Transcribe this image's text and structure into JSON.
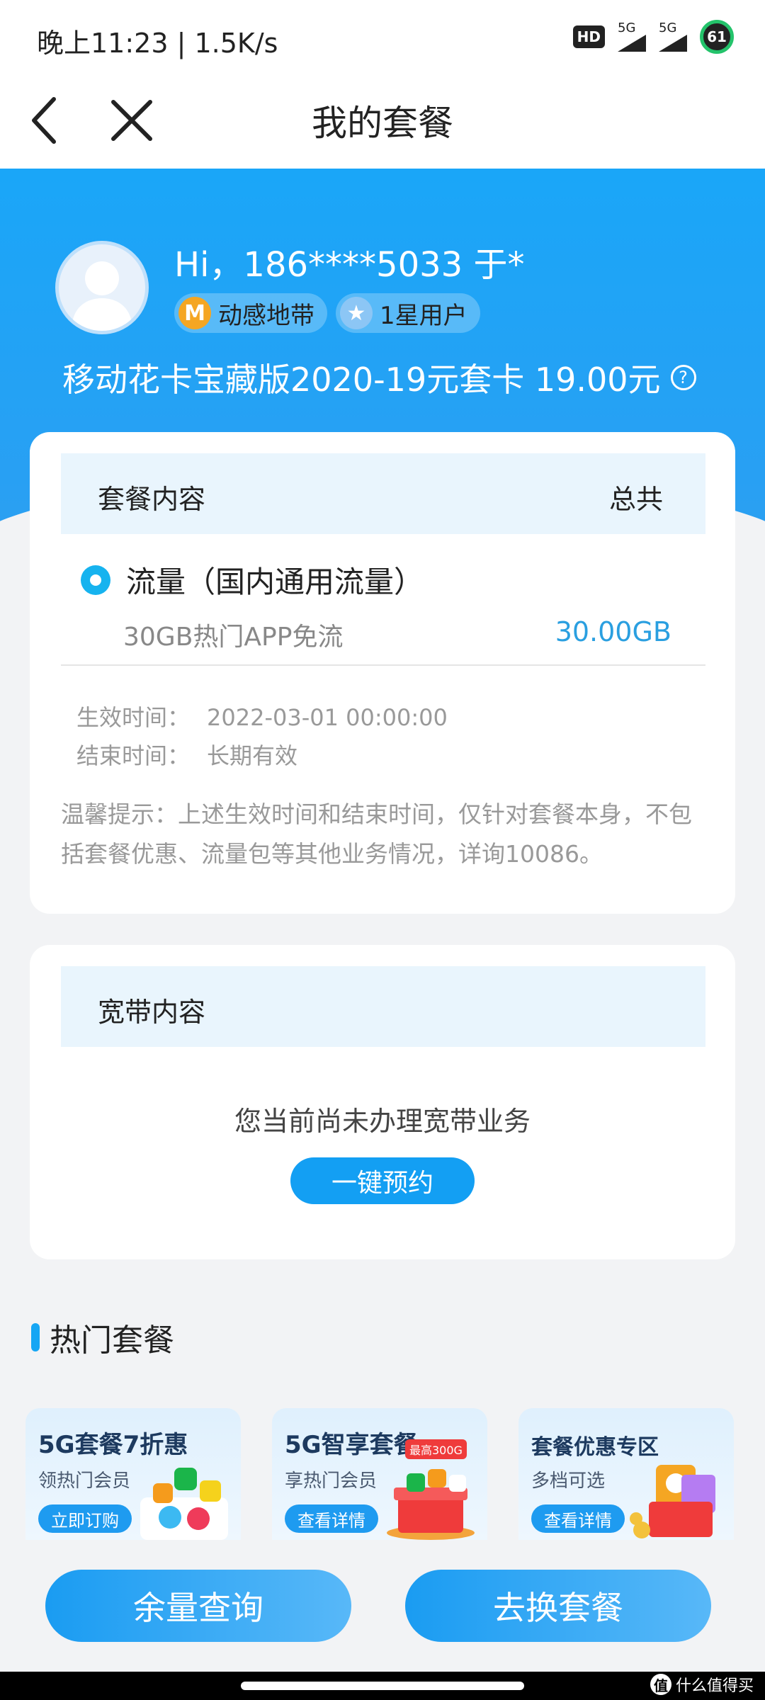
{
  "status_bar": {
    "time": "晚上11:23 | 1.5K/s",
    "hd": "HD",
    "signal1": "5G",
    "signal2": "5G",
    "battery": "61"
  },
  "header": {
    "title": "我的套餐"
  },
  "user": {
    "greeting": "Hi，186****5033 于*",
    "tag1": "动感地带",
    "tag1_icon_letter": "M",
    "tag2": "1星用户",
    "plan": "移动花卡宝藏版2020-19元套卡 19.00元",
    "help_glyph": "?"
  },
  "package_card": {
    "header_left": "套餐内容",
    "header_right": "总共",
    "item_title": "流量（国内通用流量）",
    "item_sub": "30GB热门APP免流",
    "item_value": "30.00GB",
    "start_label": "生效时间：",
    "start_value": "2022-03-01 00:00:00",
    "end_label": "结束时间：",
    "end_value": "长期有效",
    "tip": "温馨提示：上述生效时间和结束时间，仅针对套餐本身，不包括套餐优惠、流量包等其他业务情况，详询10086。"
  },
  "broadband_card": {
    "header": "宽带内容",
    "empty_text": "您当前尚未办理宽带业务",
    "button": "一键预约"
  },
  "hot": {
    "title": "热门套餐",
    "items": [
      {
        "title": "5G套餐7折惠",
        "sub": "领热门会员",
        "button": "立即订购",
        "badge": ""
      },
      {
        "title": "5G智享套餐",
        "sub": "享热门会员",
        "button": "查看详情",
        "badge": "最高300G"
      },
      {
        "title": "套餐优惠专区",
        "sub": "多档可选",
        "button": "查看详情",
        "badge": ""
      }
    ]
  },
  "bottom": {
    "left_button": "余量查询",
    "right_button": "去换套餐"
  },
  "watermark": {
    "logo": "值",
    "text": "什么值得买"
  },
  "colors": {
    "accent": "#139ff3",
    "hero": "#1aa6f8",
    "value_blue": "#2a9fe0"
  }
}
